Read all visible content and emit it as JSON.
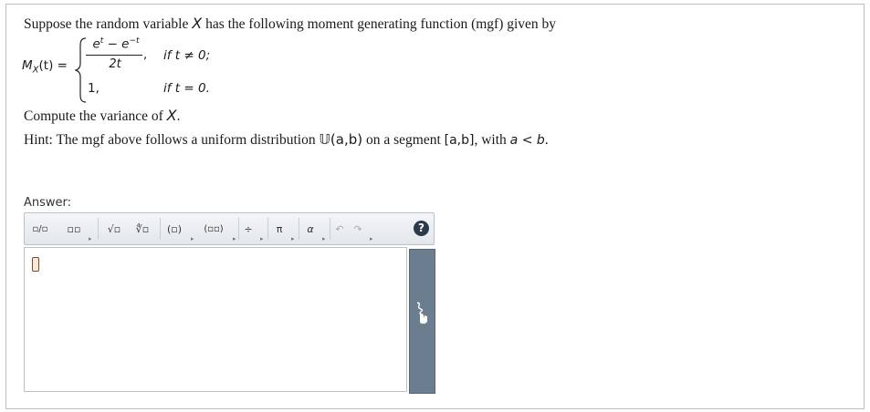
{
  "question": {
    "intro_text": "Suppose the random variable ",
    "intro_var": "X",
    "intro_rest": " has the following moment generating function (mgf) given by",
    "lhs": "M",
    "lhs_sub": "X",
    "lhs_rest": "(t) =",
    "case1_num": "e",
    "case1_num_sup1": "t",
    "case1_minus": " − e",
    "case1_num_sup2": "−t",
    "case1_den": "2t",
    "case1_comma": ",",
    "case1_cond": "if t ≠ 0;",
    "case2_val": "1,",
    "case2_cond": "if t = 0.",
    "compute_text": "Compute the variance of ",
    "compute_var": "X",
    "compute_end": ".",
    "hint_prefix": "Hint: The mgf above follows a uniform distribution ",
    "hint_dist": "𝕌(a,b)",
    "hint_mid": " on a segment ",
    "hint_seg": "[a,b]",
    "hint_comma": ", with ",
    "hint_cond": "a < b",
    "hint_end": "."
  },
  "answer": {
    "label": "Answer:",
    "toolbar": {
      "fraction": "▫/▫",
      "superscript": "▫▫",
      "sqrt": "√▫",
      "nthroot": "∜▫",
      "paren": "(▫)",
      "matrix": "(▫▫)",
      "divide": "÷",
      "pi": "π",
      "alpha": "α",
      "undo": "↶",
      "redo": "↷",
      "help": "?"
    }
  }
}
